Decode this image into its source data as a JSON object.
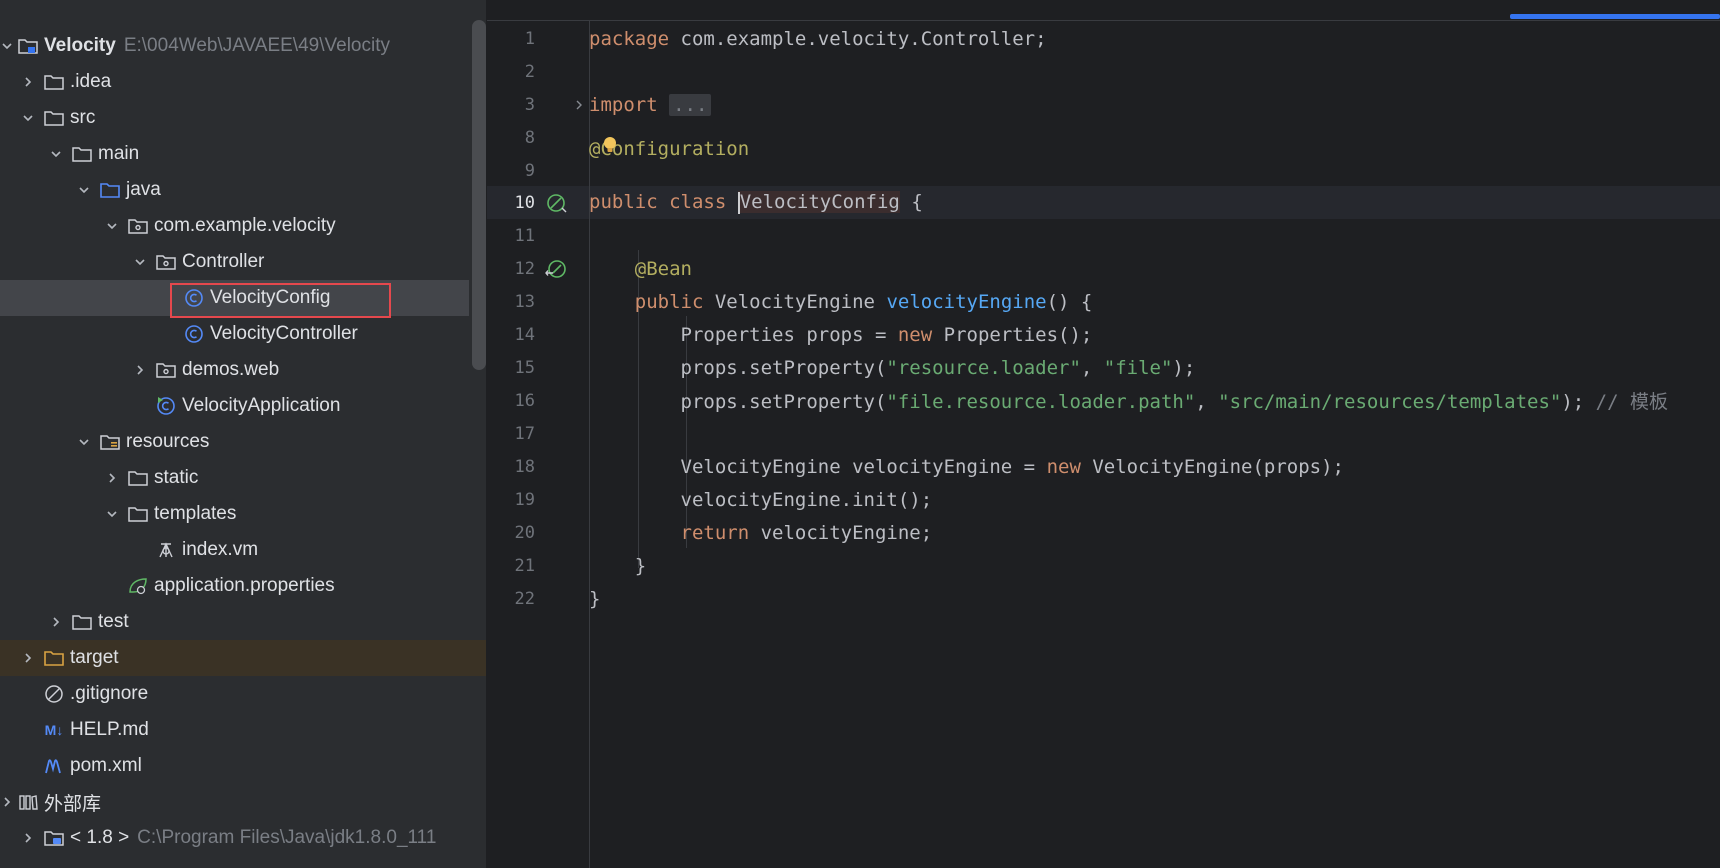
{
  "tree": {
    "root": {
      "name": "Velocity",
      "path": "E:\\004Web\\JAVAEE\\49\\Velocity"
    },
    "items": [
      {
        "label": ".idea"
      },
      {
        "label": "src"
      },
      {
        "label": "main"
      },
      {
        "label": "java"
      },
      {
        "label": "com.example.velocity"
      },
      {
        "label": "Controller"
      },
      {
        "label": "VelocityConfig"
      },
      {
        "label": "VelocityController"
      },
      {
        "label": "demos.web"
      },
      {
        "label": "VelocityApplication"
      },
      {
        "label": "resources"
      },
      {
        "label": "static"
      },
      {
        "label": "templates"
      },
      {
        "label": "index.vm"
      },
      {
        "label": "application.properties"
      },
      {
        "label": "test"
      },
      {
        "label": "target"
      },
      {
        "label": ".gitignore"
      },
      {
        "label": "HELP.md"
      },
      {
        "label": "pom.xml"
      },
      {
        "label": "外部库"
      },
      {
        "label": "< 1.8 >",
        "path": "C:\\Program Files\\Java\\jdk1.8.0_111"
      }
    ],
    "help_md_badge": "M↓"
  },
  "editor": {
    "line_numbers": [
      "1",
      "2",
      "3",
      "8",
      "9",
      "10",
      "11",
      "12",
      "13",
      "14",
      "15",
      "16",
      "17",
      "18",
      "19",
      "20",
      "21",
      "22"
    ],
    "code": {
      "l1_kw": "package",
      "l1_rest": " com.example.velocity.Controller;",
      "l3_kw": "import",
      "l3_fold": "...",
      "l9_ann": "@Configuration",
      "l10_kw": "public class ",
      "l10_cls": "VelocityConfig",
      "l10_rest": " {",
      "l12_ann": "@Bean",
      "l13_kw": "public",
      "l13_type": " VelocityEngine ",
      "l13_fn": "velocityEngine",
      "l13_rest": "() {",
      "l14_a": "Properties props = ",
      "l14_kw": "new",
      "l14_b": " Properties();",
      "l15_a": "props.setProperty(",
      "l15_s1": "\"resource.loader\"",
      "l15_sep": ", ",
      "l15_s2": "\"file\"",
      "l15_b": ");",
      "l16_a": "props.setProperty(",
      "l16_s1": "\"file.resource.loader.path\"",
      "l16_sep": ", ",
      "l16_s2": "\"src/main/resources/templates\"",
      "l16_b": "); ",
      "l16_cmt": "// 模板",
      "l18_a": "VelocityEngine velocityEngine = ",
      "l18_kw": "new",
      "l18_b": " VelocityEngine(props);",
      "l19": "velocityEngine.init();",
      "l20_kw": "return",
      "l20_b": " velocityEngine;",
      "l21": "}",
      "l22": "}"
    }
  },
  "colors": {
    "accent": "#3574f0",
    "selection_box": "#e5484d"
  }
}
